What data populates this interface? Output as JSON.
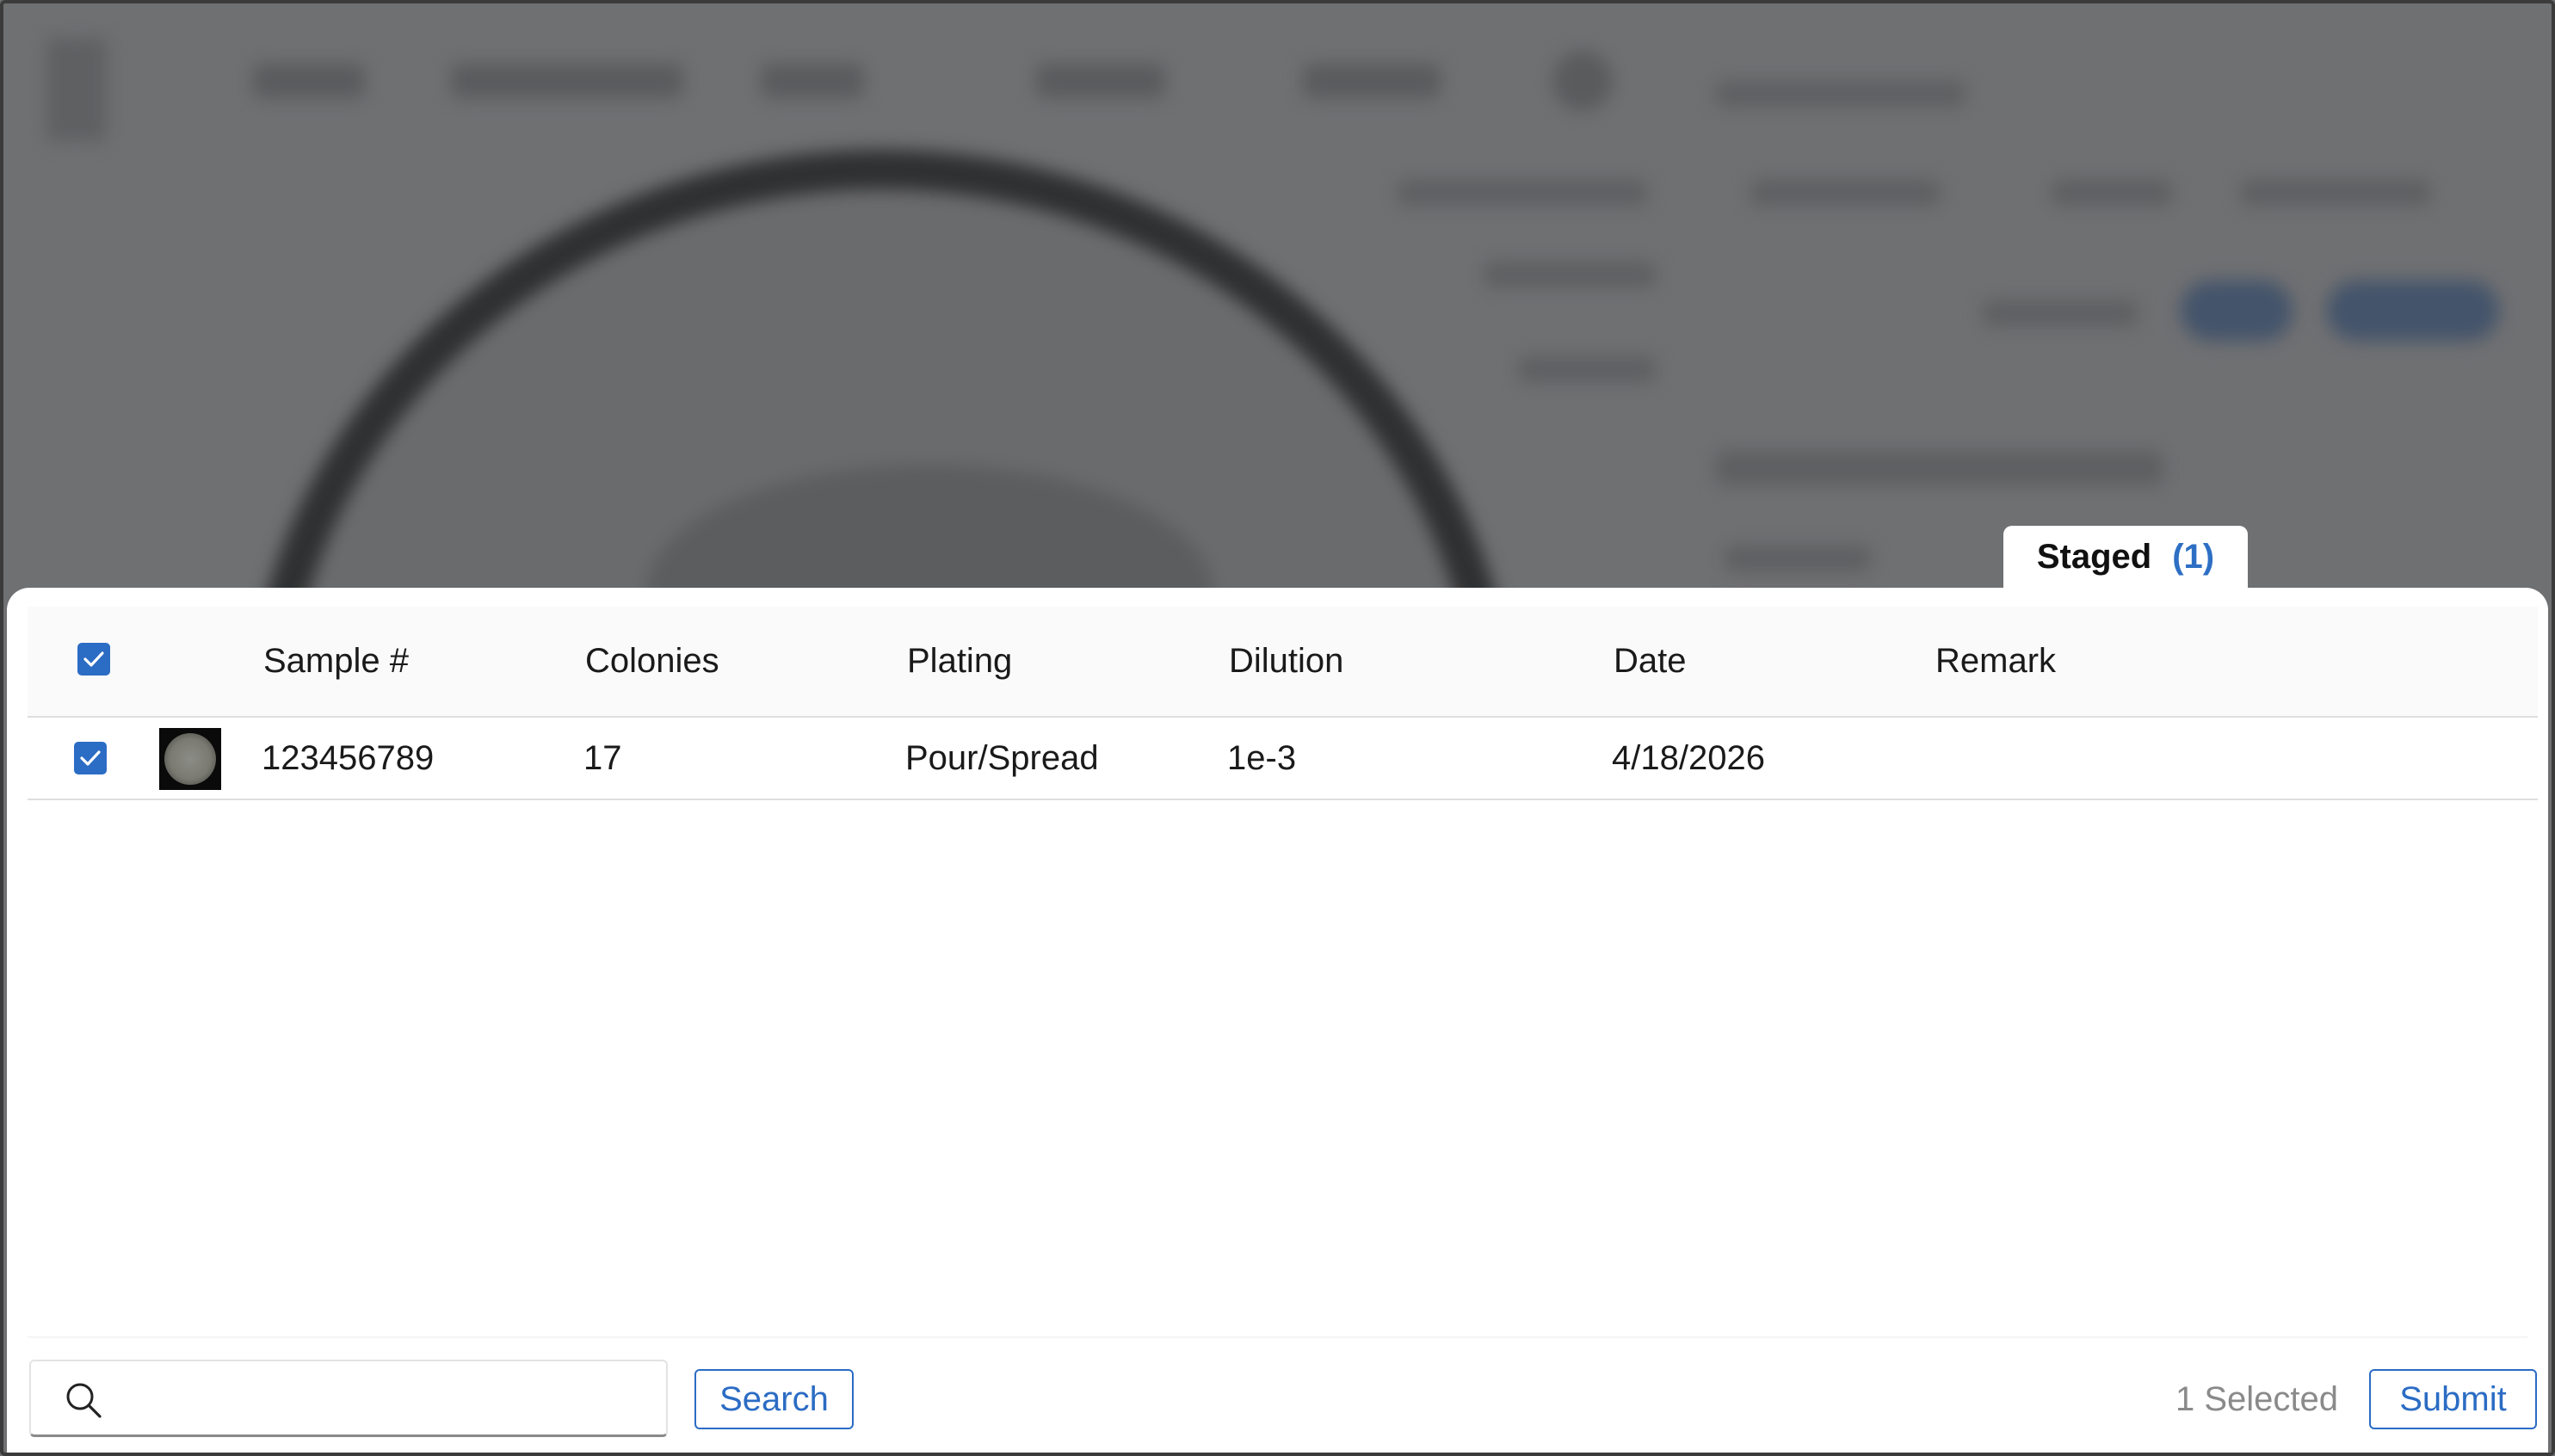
{
  "staged_tab": {
    "label": "Staged",
    "count": "(1)"
  },
  "table": {
    "headers": [
      "Sample #",
      "Colonies",
      "Plating",
      "Dilution",
      "Date",
      "Remark"
    ],
    "rows": [
      {
        "sample": "123456789",
        "colonies": "17",
        "plating": "Pour/Spread",
        "dilution": "1e-3",
        "date": "4/18/2026",
        "remark": "",
        "selected": true
      }
    ]
  },
  "footer": {
    "search_placeholder": "",
    "search_button": "Search",
    "selected_text": "1 Selected",
    "submit_button": "Submit"
  },
  "colors": {
    "accent": "#2b6cc4",
    "overlay": "#6f7072"
  }
}
